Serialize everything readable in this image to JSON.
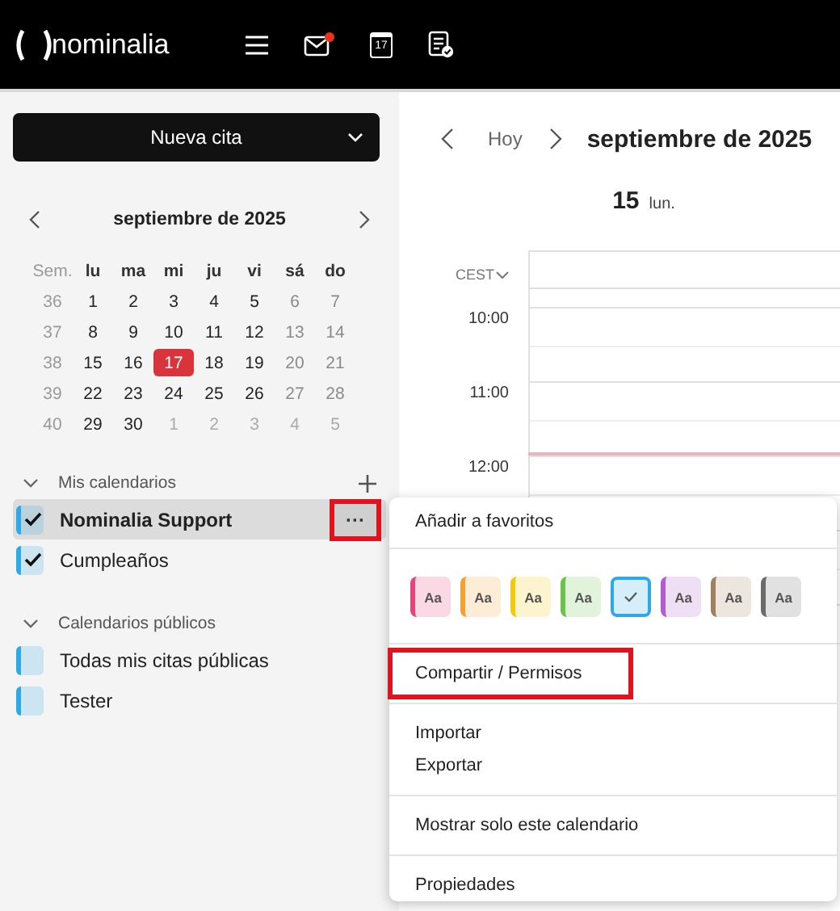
{
  "topbar": {
    "logo": "nominalia",
    "mail_unread": true,
    "calendar_day": "17"
  },
  "sidebar": {
    "new_button": "Nueva cita",
    "mini_calendar": {
      "title": "septiembre de 2025",
      "week_header": "Sem.",
      "weekdays": [
        "lu",
        "ma",
        "mi",
        "ju",
        "vi",
        "sá",
        "do"
      ],
      "weeks": [
        {
          "week": "36",
          "days": [
            {
              "label": "1",
              "muted": false,
              "selected": false
            },
            {
              "label": "2",
              "muted": false,
              "selected": false
            },
            {
              "label": "3",
              "muted": false,
              "selected": false
            },
            {
              "label": "4",
              "muted": false,
              "selected": false
            },
            {
              "label": "5",
              "muted": false,
              "selected": false
            },
            {
              "label": "6",
              "muted": false,
              "selected": false
            },
            {
              "label": "7",
              "muted": false,
              "selected": false
            }
          ]
        },
        {
          "week": "37",
          "days": [
            {
              "label": "8",
              "muted": false,
              "selected": false
            },
            {
              "label": "9",
              "muted": false,
              "selected": false
            },
            {
              "label": "10",
              "muted": false,
              "selected": false
            },
            {
              "label": "11",
              "muted": false,
              "selected": false
            },
            {
              "label": "12",
              "muted": false,
              "selected": false
            },
            {
              "label": "13",
              "muted": false,
              "selected": false
            },
            {
              "label": "14",
              "muted": false,
              "selected": false
            }
          ]
        },
        {
          "week": "38",
          "days": [
            {
              "label": "15",
              "muted": false,
              "selected": false
            },
            {
              "label": "16",
              "muted": false,
              "selected": false
            },
            {
              "label": "17",
              "muted": false,
              "selected": true
            },
            {
              "label": "18",
              "muted": false,
              "selected": false
            },
            {
              "label": "19",
              "muted": false,
              "selected": false
            },
            {
              "label": "20",
              "muted": false,
              "selected": false
            },
            {
              "label": "21",
              "muted": false,
              "selected": false
            }
          ]
        },
        {
          "week": "39",
          "days": [
            {
              "label": "22",
              "muted": false,
              "selected": false
            },
            {
              "label": "23",
              "muted": false,
              "selected": false
            },
            {
              "label": "24",
              "muted": false,
              "selected": false
            },
            {
              "label": "25",
              "muted": false,
              "selected": false
            },
            {
              "label": "26",
              "muted": false,
              "selected": false
            },
            {
              "label": "27",
              "muted": false,
              "selected": false
            },
            {
              "label": "28",
              "muted": false,
              "selected": false
            }
          ]
        },
        {
          "week": "40",
          "days": [
            {
              "label": "29",
              "muted": false,
              "selected": false
            },
            {
              "label": "30",
              "muted": false,
              "selected": false
            },
            {
              "label": "1",
              "muted": true,
              "selected": false
            },
            {
              "label": "2",
              "muted": true,
              "selected": false
            },
            {
              "label": "3",
              "muted": true,
              "selected": false
            },
            {
              "label": "4",
              "muted": true,
              "selected": false
            },
            {
              "label": "5",
              "muted": true,
              "selected": false
            }
          ]
        }
      ]
    },
    "sections": [
      {
        "title": "Mis calendarios",
        "expanded": true,
        "can_add": true,
        "calendars": [
          {
            "label": "Nominalia Support",
            "checked": true,
            "selected": true,
            "color": "#2ea8e8",
            "more": {
              "label": "···",
              "annotated": true
            }
          },
          {
            "label": "Cumpleaños",
            "checked": true,
            "selected": false,
            "color": "#2ea8e8"
          }
        ]
      },
      {
        "title": "Calendarios públicos",
        "expanded": true,
        "can_add": false,
        "calendars": [
          {
            "label": "Todas mis citas públicas",
            "checked": false,
            "selected": false,
            "color": "#2ea8e8"
          },
          {
            "label": "Tester",
            "checked": false,
            "selected": false,
            "color": "#2ea8e8"
          }
        ]
      }
    ]
  },
  "main": {
    "today_button": "Hoy",
    "title": "septiembre de 2025",
    "day_number": "15",
    "day_name": "lun.",
    "timezone": "CEST",
    "hours": [
      "10:00",
      "11:00",
      "12:00"
    ]
  },
  "menu": {
    "sections": [
      {
        "kind": "items",
        "items": [
          {
            "label": "Añadir a favoritos",
            "annotated": false
          }
        ]
      },
      {
        "kind": "colors",
        "swatches": [
          {
            "label": "Aa",
            "color": "#e8437a",
            "selected": false
          },
          {
            "label": "Aa",
            "color": "#f5a030",
            "selected": false
          },
          {
            "label": "Aa",
            "color": "#f2c811",
            "selected": false
          },
          {
            "label": "Aa",
            "color": "#6cc24a",
            "selected": false
          },
          {
            "color": "#2ea8e8",
            "selected": true
          },
          {
            "label": "Aa",
            "color": "#b05ecf",
            "selected": false
          },
          {
            "label": "Aa",
            "color": "#a08060",
            "selected": false
          },
          {
            "label": "Aa",
            "color": "#6b6b6b",
            "selected": false
          }
        ]
      },
      {
        "kind": "items",
        "items": [
          {
            "label": "Compartir / Permisos",
            "annotated": true
          }
        ]
      },
      {
        "kind": "items",
        "items": [
          {
            "label": "Importar",
            "annotated": false
          },
          {
            "label": "Exportar",
            "annotated": false
          }
        ]
      },
      {
        "kind": "items",
        "items": [
          {
            "label": "Mostrar solo este calendario",
            "annotated": false
          }
        ]
      },
      {
        "kind": "items",
        "items": [
          {
            "label": "Propiedades",
            "annotated": false
          }
        ]
      }
    ]
  }
}
